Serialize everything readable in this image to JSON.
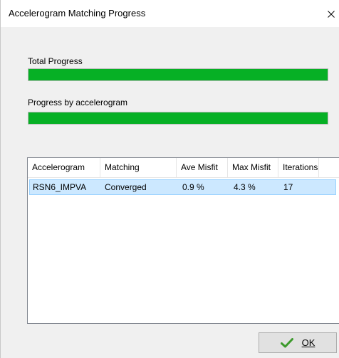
{
  "window": {
    "title": "Accelerogram Matching Progress"
  },
  "total_progress": {
    "label": "Total Progress",
    "value_percent": 100
  },
  "progress_by_accelerogram": {
    "label": "Progress by accelerogram",
    "value_percent": 100
  },
  "table": {
    "columns": [
      "Accelerogram",
      "Matching",
      "Ave Misfit",
      "Max Misfit",
      "Iterations"
    ],
    "rows": [
      {
        "accelerogram": "RSN6_IMPVA",
        "matching": "Converged",
        "ave_misfit": "0.9 %",
        "max_misfit": "4.3 %",
        "iterations": "17"
      }
    ]
  },
  "ok_button": {
    "label": "OK",
    "icon": "checkmark-icon",
    "icon_color": "#3c9a2c"
  },
  "colors": {
    "progress_fill": "#06b025",
    "selection": "#cce8ff"
  }
}
